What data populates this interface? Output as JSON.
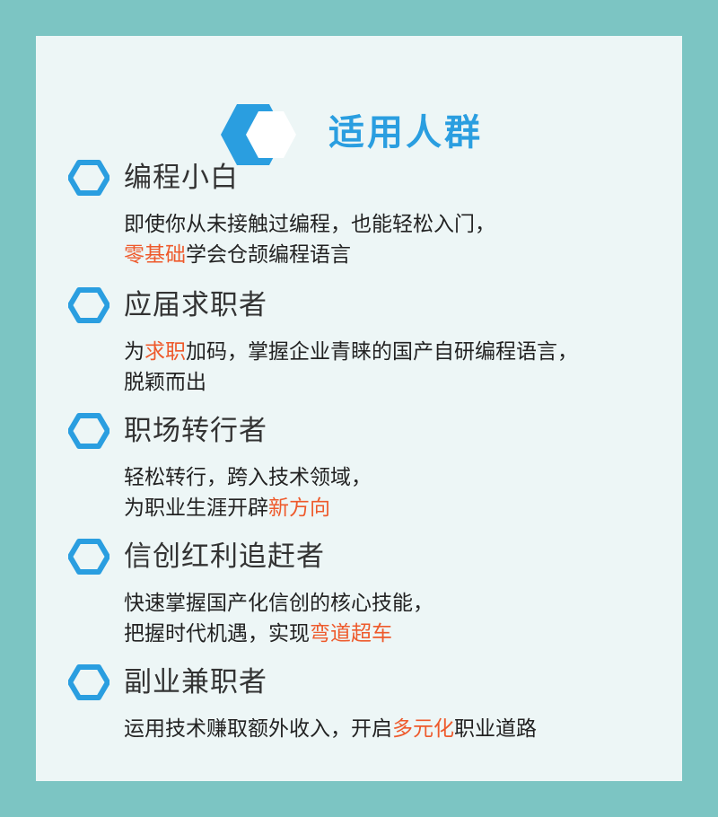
{
  "header": {
    "title": "适用人群",
    "icon": "hexagon-logo-icon"
  },
  "colors": {
    "background": "#7cc5c3",
    "card": "#edf6f6",
    "accent": "#2a9ee0",
    "highlight": "#ee5a2c"
  },
  "sections": [
    {
      "title": "编程小白",
      "line1": {
        "before": "即使你从未接触过编程，也能轻松入门，",
        "highlight": "",
        "after": ""
      },
      "line2": {
        "before": "",
        "highlight": "零基础",
        "after": "学会仓颉编程语言"
      }
    },
    {
      "title": "应届求职者",
      "line1": {
        "before": "为",
        "highlight": "求职",
        "after": "加码，掌握企业青睐的国产自研编程语言，"
      },
      "line2": {
        "before": "脱颖而出",
        "highlight": "",
        "after": ""
      }
    },
    {
      "title": "职场转行者",
      "line1": {
        "before": "轻松转行，跨入技术领域，",
        "highlight": "",
        "after": ""
      },
      "line2": {
        "before": "为职业生涯开辟",
        "highlight": "新方向",
        "after": ""
      }
    },
    {
      "title": "信创红利追赶者",
      "line1": {
        "before": "快速掌握国产化信创的核心技能，",
        "highlight": "",
        "after": ""
      },
      "line2": {
        "before": "把握时代机遇，实现",
        "highlight": "弯道超车",
        "after": ""
      }
    },
    {
      "title": "副业兼职者",
      "line1": {
        "before": "运用技术赚取额外收入，开启",
        "highlight": "多元化",
        "after": "职业道路"
      },
      "line2": {
        "before": "",
        "highlight": "",
        "after": ""
      }
    }
  ]
}
